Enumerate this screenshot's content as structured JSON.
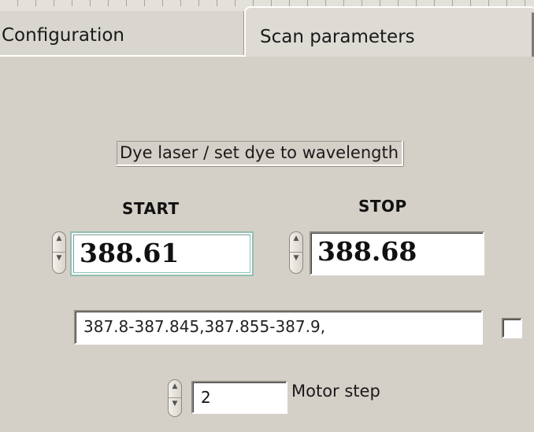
{
  "tabs": {
    "configuration": "Configuration",
    "scan_parameters": "Scan parameters",
    "active": "Scan parameters"
  },
  "scan": {
    "dye_label": "Dye laser / set dye to wavelength",
    "start_caption": "START",
    "stop_caption": "STOP",
    "start_value": "388.61",
    "stop_value": "388.68",
    "ranges_value": "387.8-387.845,387.855-387.9,",
    "checkbox_checked": false,
    "motor_step_value": "2",
    "motor_step_label": "Motor step"
  },
  "icons": {
    "spinner": "up-down-arrows-icon"
  },
  "colors": {
    "background": "#d4d0c8",
    "active_field_border": "#8fbfb1"
  }
}
